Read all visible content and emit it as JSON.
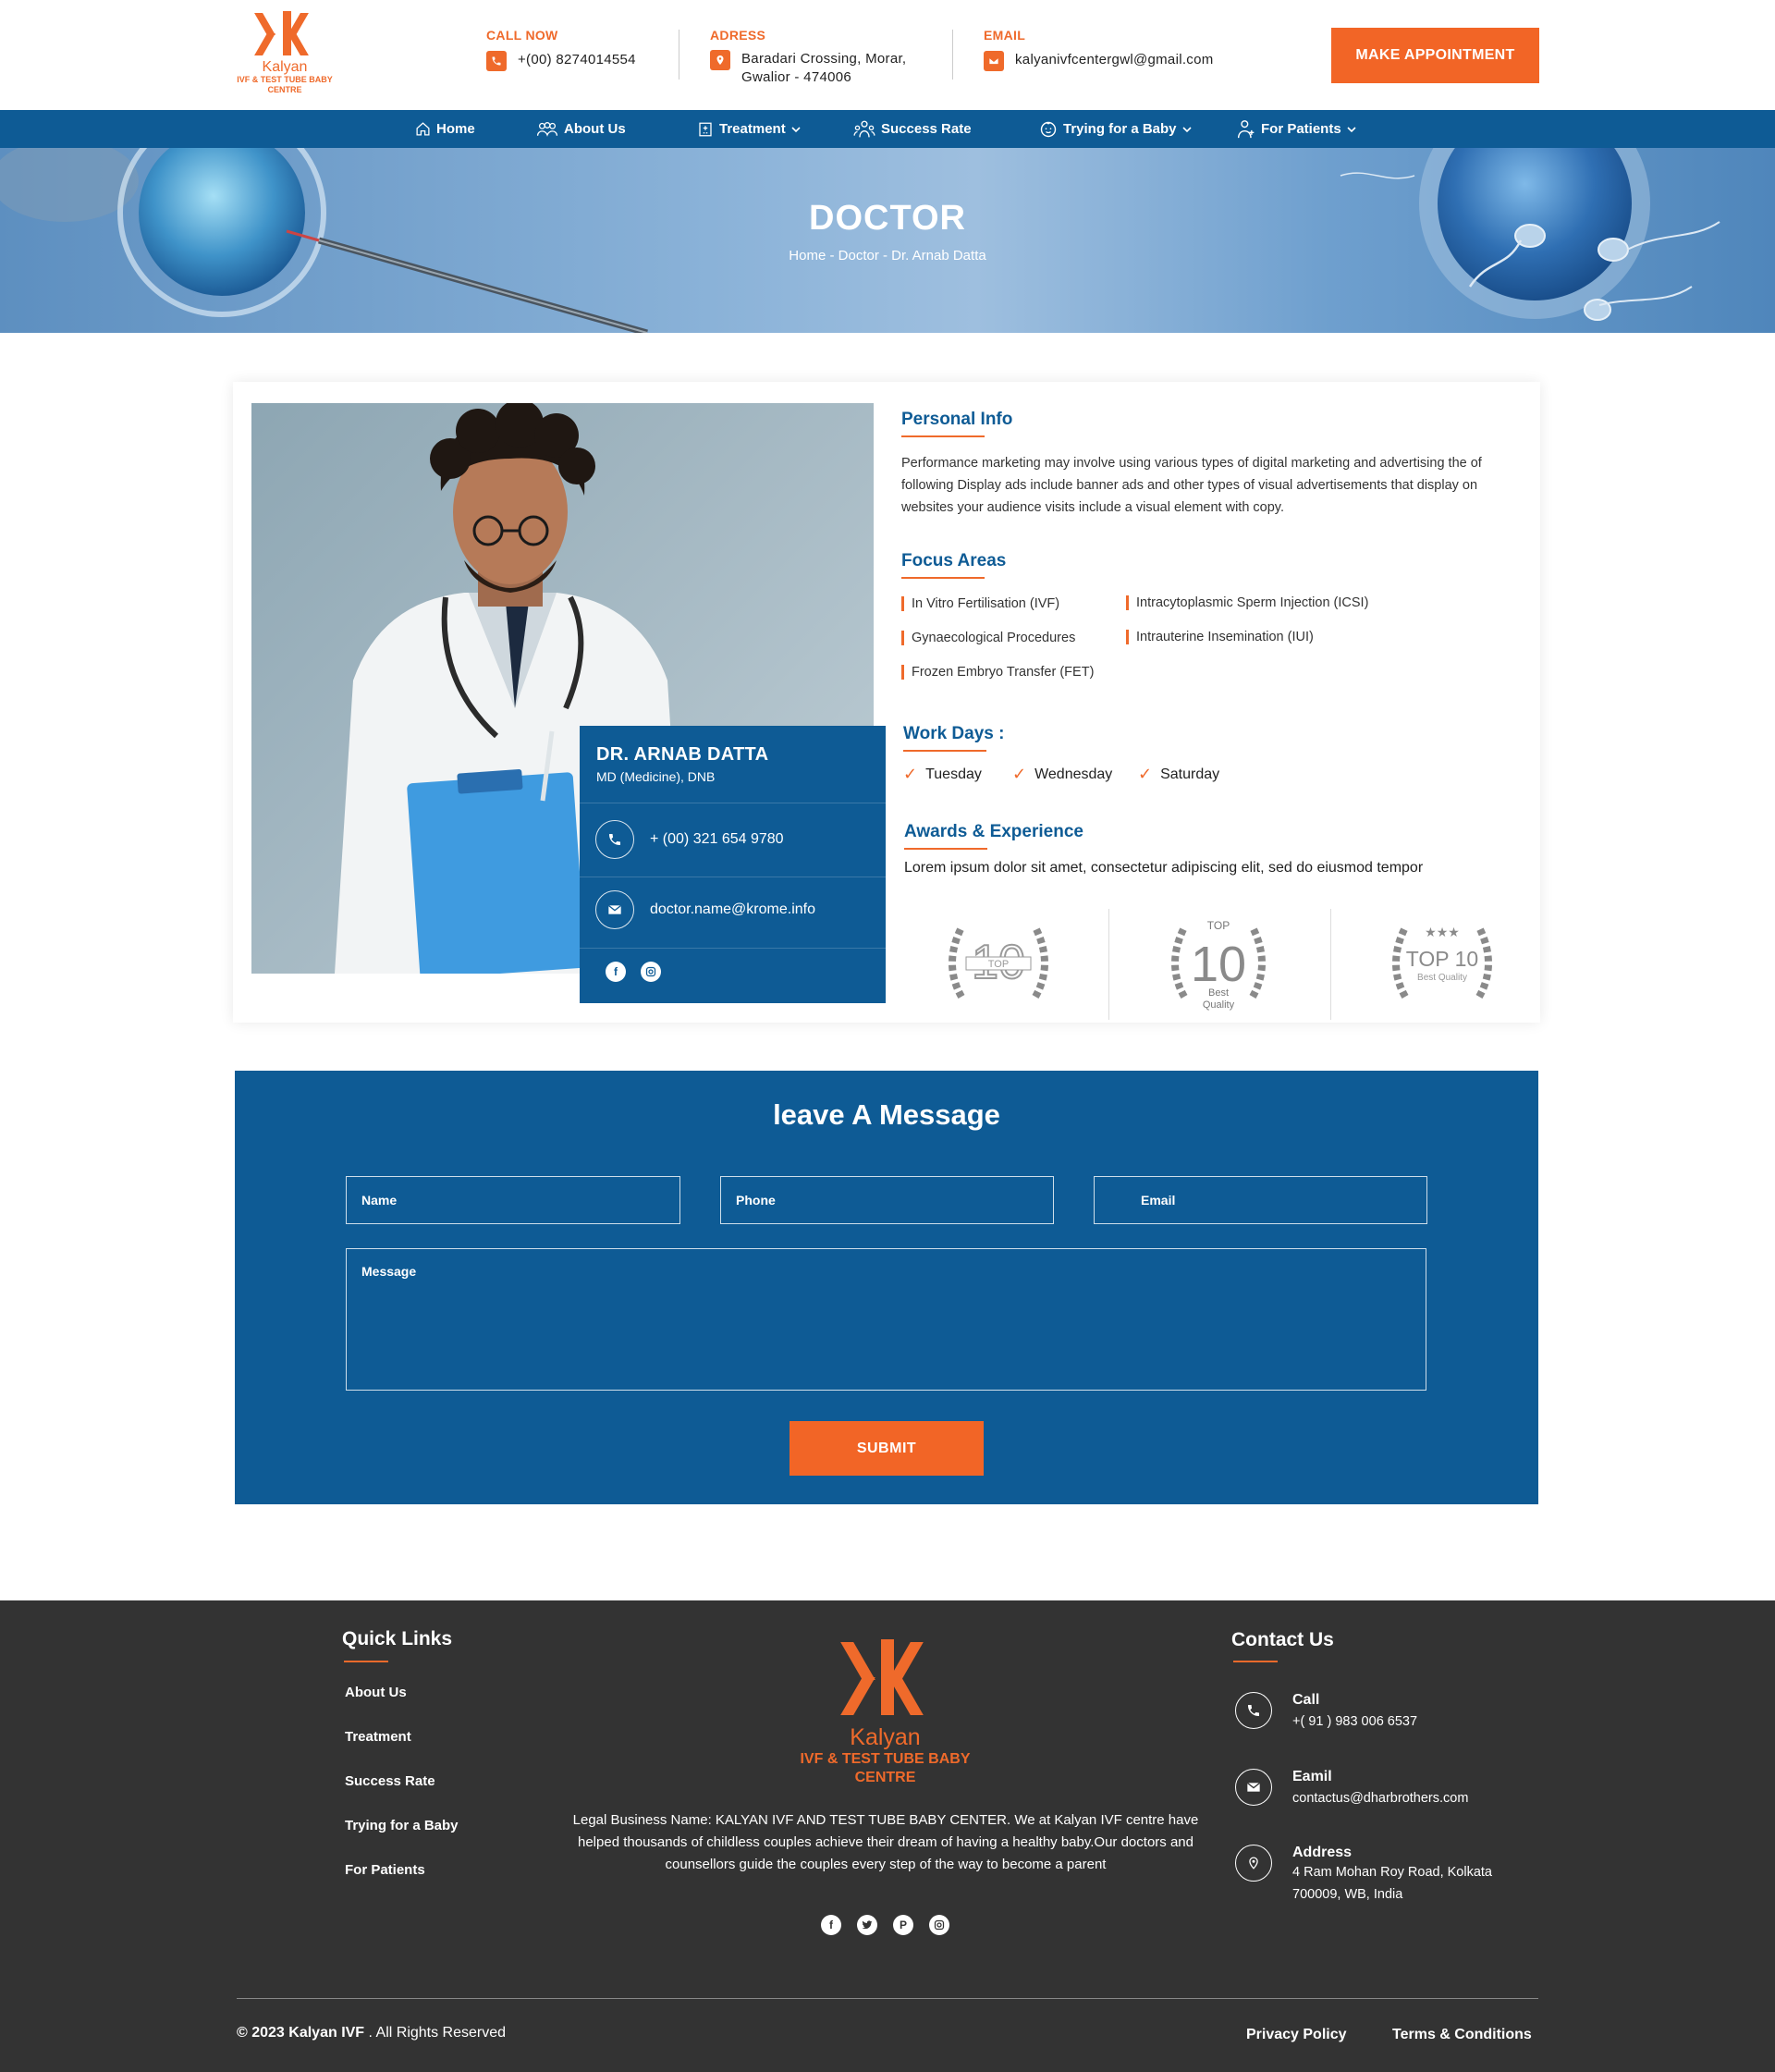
{
  "brand": {
    "name": "Kalyan",
    "tagline": "IVF & TEST TUBE BABY CENTRE",
    "accent_color": "#ef6a2b",
    "primary_color": "#0e5b95"
  },
  "header": {
    "call": {
      "label": "CALL NOW",
      "value": "+(00) 8274014554",
      "icon": "phone-icon"
    },
    "address": {
      "label": "ADRESS",
      "line1": "Baradari Crossing, Morar,",
      "line2": "Gwalior - 474006",
      "icon": "map-pin-icon"
    },
    "email": {
      "label": "EMAIL",
      "value": "kalyanivfcentergwl@gmail.com",
      "icon": "mail-icon"
    },
    "appointment_label": "MAKE APPOINTMENT"
  },
  "nav": {
    "items": [
      {
        "label": "Home",
        "icon": "home-icon",
        "dropdown": false
      },
      {
        "label": "About Us",
        "icon": "group-icon",
        "dropdown": false
      },
      {
        "label": "Treatment",
        "icon": "hospital-icon",
        "dropdown": true
      },
      {
        "label": "Success Rate",
        "icon": "people-icon",
        "dropdown": false
      },
      {
        "label": "Trying for a Baby",
        "icon": "baby-icon",
        "dropdown": true
      },
      {
        "label": "For Patients",
        "icon": "patient-icon",
        "dropdown": true
      }
    ]
  },
  "banner": {
    "title": "DOCTOR",
    "breadcrumb": "Home - Doctor - Dr. Arnab Datta"
  },
  "doctor": {
    "name": "DR. ARNAB DATTA",
    "degree": "MD (Medicine), DNB",
    "phone": "+ (00) 321 654 9780",
    "email": "doctor.name@krome.info",
    "social": [
      "facebook-icon",
      "instagram-icon"
    ]
  },
  "personal_info": {
    "heading": "Personal Info",
    "text": "Performance marketing may involve using various types of digital marketing and advertising the of following Display ads include banner ads and other types of visual advertisements that display on websites your audience visits include a visual element with copy."
  },
  "focus_areas": {
    "heading": "Focus Areas",
    "items": [
      "In Vitro Fertilisation (IVF)",
      "Intracytoplasmic Sperm Injection (ICSI)",
      "Gynaecological Procedures",
      "Intrauterine Insemination (IUI)",
      "Frozen Embryo Transfer (FET)"
    ]
  },
  "work_days": {
    "heading": "Work Days :",
    "days": [
      "Tuesday",
      "Wednesday",
      "Saturday"
    ]
  },
  "awards": {
    "heading": "Awards & Experience",
    "text": "Lorem ipsum dolor sit amet, consectetur adipiscing elit, sed do eiusmod tempor",
    "badges": [
      {
        "top": "TOP",
        "number": "10",
        "sub": ""
      },
      {
        "top": "TOP",
        "number": "10",
        "sub": "Best",
        "sub2": "Quality"
      },
      {
        "top": "",
        "number": "TOP 10",
        "sub": "Best Quality"
      }
    ]
  },
  "message_form": {
    "title": "leave A Message",
    "name_placeholder": "Name",
    "phone_placeholder": "Phone",
    "email_placeholder": "Email",
    "message_placeholder": "Message",
    "submit_label": "SUBMIT"
  },
  "footer": {
    "quick_links_heading": "Quick Links",
    "quick_links": [
      "About Us",
      "Treatment",
      "Success Rate",
      "Trying for a Baby",
      "For Patients"
    ],
    "about": "Legal Business Name: KALYAN IVF AND TEST TUBE BABY CENTER. We at Kalyan IVF centre have helped thousands of childless couples achieve their dream of having a healthy baby.Our doctors and counsellors guide the couples every step of the way to become a parent",
    "social": [
      "facebook-icon",
      "twitter-icon",
      "pinterest-icon",
      "instagram-icon"
    ],
    "contact_heading": "Contact Us",
    "contact": [
      {
        "title": "Call",
        "value": "+( 91 ) 983 006 6537",
        "icon": "phone-icon"
      },
      {
        "title": "Eamil",
        "value": "contactus@dharbrothers.com",
        "icon": "mail-icon"
      },
      {
        "title": "Address",
        "value": "4 Ram Mohan Roy Road, Kolkata",
        "value2": "700009, WB, India",
        "icon": "map-pin-icon"
      }
    ],
    "copyright_bold": "© 2023 Kalyan IVF",
    "copyright_rest": " . All Rights Reserved",
    "privacy_label": "Privacy Policy",
    "terms_label": "Terms & Conditions"
  }
}
